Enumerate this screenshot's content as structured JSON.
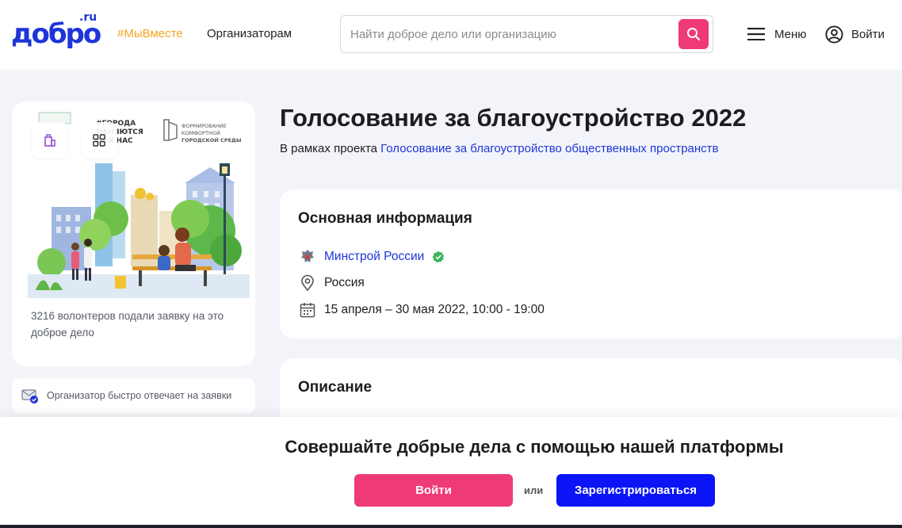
{
  "header": {
    "logo_text": "добро",
    "logo_suffix": ".ru",
    "tag": "#МыВместе",
    "organizers_link": "Организаторам",
    "search_placeholder": "Найти доброе дело или организацию",
    "menu_label": "Меню",
    "login_label": "Войти"
  },
  "event_card": {
    "illustration_text": {
      "hashtag": "#ГОРОДА\nМЕНЯЮТСЯ\nДЛЯ НАС",
      "program": "ФОРМИРОВАНИЕ\nКОМФОРТНОЙ\nГОРОДСКОЙ СРЕДЫ"
    },
    "volunteers_text": "3216 волонтеров подали заявку на это доброе дело",
    "fast_reply_text": "Организатор быстро отвечает на заявки"
  },
  "main": {
    "title": "Голосование за благоустройство 2022",
    "project_prefix": "В рамках проекта ",
    "project_link": "Голосование за благоустройство общественных пространств",
    "info": {
      "heading": "Основная информация",
      "organizer": "Минстрой России",
      "location": "Россия",
      "dates": "15 апреля – 30 мая 2022, 10:00 - 19:00"
    },
    "description": {
      "heading": "Описание"
    }
  },
  "banner": {
    "text": "Совершайте добрые дела с помощью нашей платформы",
    "login_button": "Войти",
    "or_label": "или",
    "register_button": "Зарегистрироваться"
  },
  "colors": {
    "brand_blue": "#1e35d8",
    "accent_pink": "#ef3a79",
    "register_blue": "#0a14f5",
    "tag_orange": "#f5a623",
    "verified_green": "#3cb55b"
  }
}
